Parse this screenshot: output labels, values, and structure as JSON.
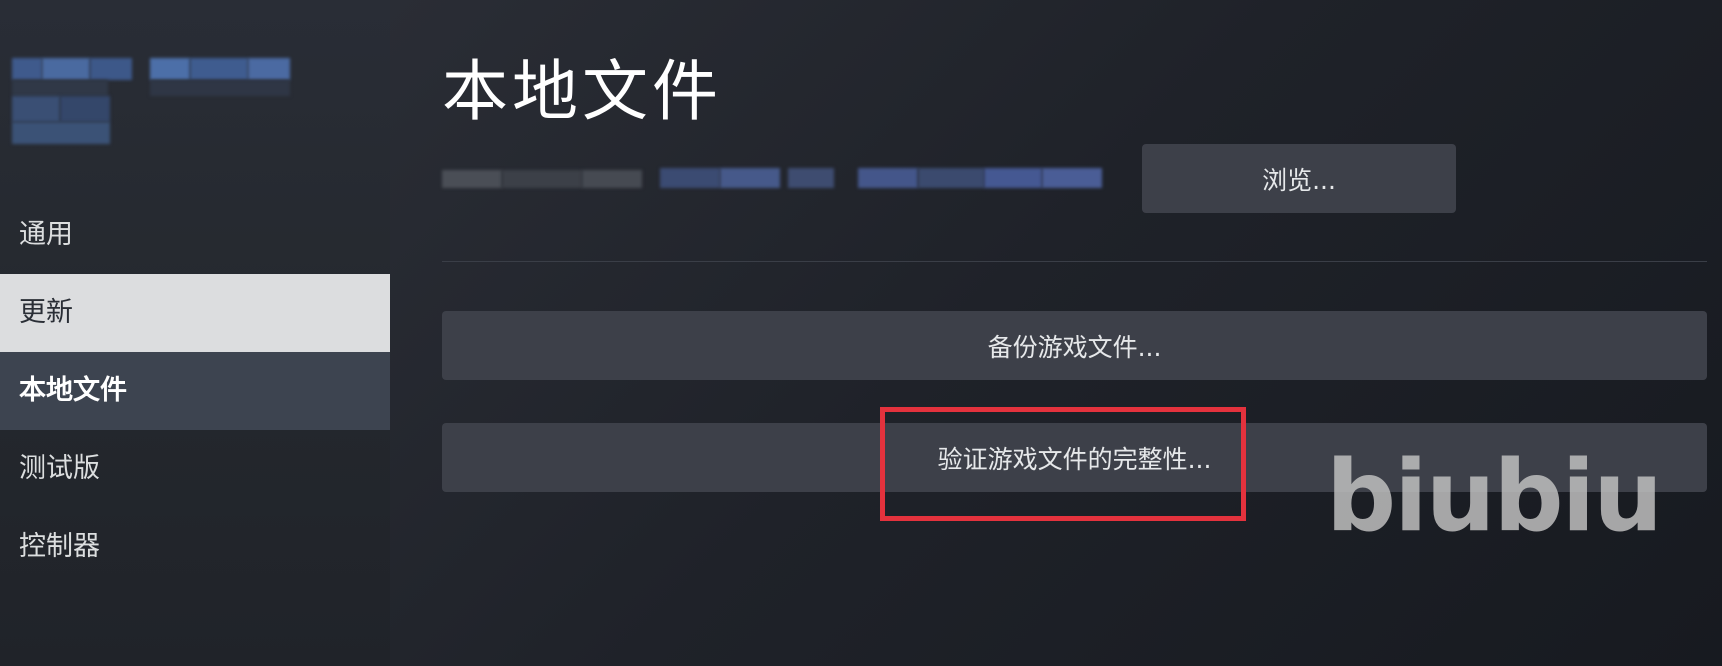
{
  "sidebar": {
    "nav_items": [
      {
        "label": "通用",
        "state": "normal"
      },
      {
        "label": "更新",
        "state": "hover"
      },
      {
        "label": "本地文件",
        "state": "active"
      },
      {
        "label": "测试版",
        "state": "normal"
      },
      {
        "label": "控制器",
        "state": "normal"
      }
    ]
  },
  "main": {
    "title": "本地文件",
    "browse_label": "浏览...",
    "backup_label": "备份游戏文件...",
    "verify_label": "验证游戏文件的完整性..."
  },
  "highlight_color": "#e4323d",
  "watermark": "biubiu"
}
